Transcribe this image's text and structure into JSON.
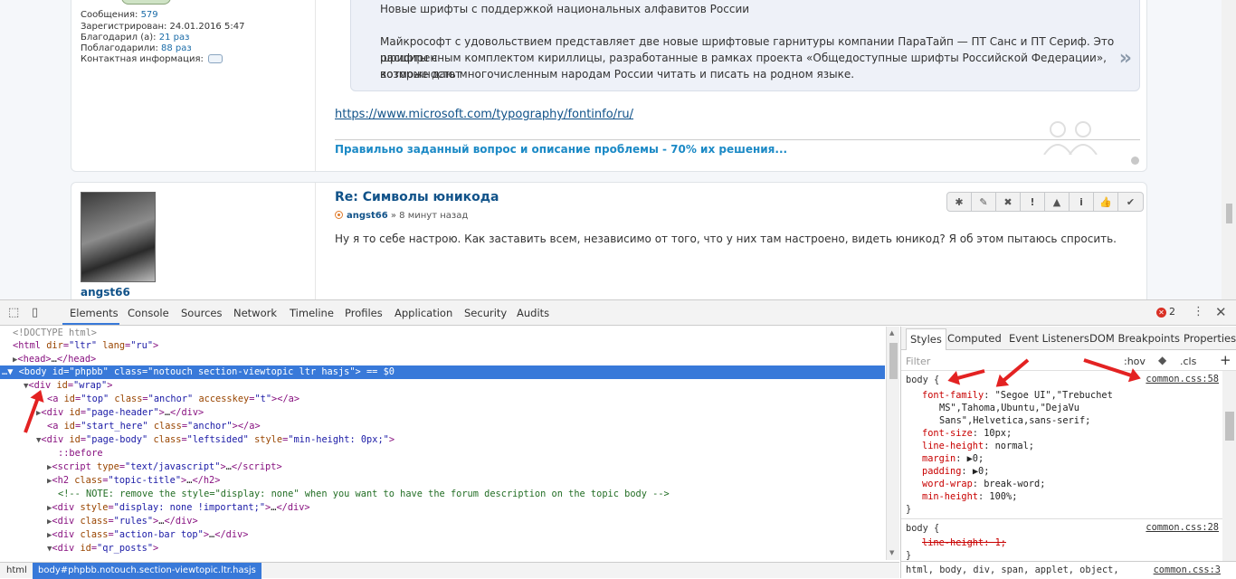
{
  "post1": {
    "profile": [
      {
        "label": "Сообщения: ",
        "value": "579"
      },
      {
        "label": "Зарегистрирован: 24.01.2016 5:47",
        "value": ""
      },
      {
        "label": "Благодарил (а): ",
        "value": "21 раз"
      },
      {
        "label": "Поблагодарили: ",
        "value": "88 раз"
      },
      {
        "label": "Контактная информация: ",
        "value": ""
      }
    ],
    "quote_title": "Новые шрифты с поддержкой национальных алфавитов России",
    "quote_body_1": "Майкрософт с удовольствием представляет две новые шрифтовые гарнитуры компании ПараТайп — ПТ Санс и ПТ Сериф. Это шрифты с",
    "quote_body_2": "расширенным комплектом кириллицы, разработанные в рамках проекта «Общедоступные шрифты Российской Федерации», которые дают",
    "quote_body_3": "возможность многочисленным народам России читать и писать на родном языке.",
    "quote_more": "»",
    "link": "https://www.microsoft.com/typography/fontinfo/ru/",
    "signature": "Правильно заданный вопрос и описание проблемы - 70% их решения..."
  },
  "post2": {
    "username": "angst66",
    "title": "Re: Символы юникода",
    "meta_user": "angst66",
    "meta_time": " » 8 минут назад",
    "text": "Ну я то себе настрою. Как заставить всем, независимо от того, что у них там настроено, видеть юникод? Я об этом пытаюсь спросить.",
    "tools": [
      "✱",
      "✎",
      "✖",
      "!",
      "▲",
      "i",
      "👍",
      "✔"
    ]
  },
  "devtools": {
    "tabs": [
      "Elements",
      "Console",
      "Sources",
      "Network",
      "Timeline",
      "Profiles",
      "Application",
      "Security",
      "Audits"
    ],
    "error_count": "2",
    "breadcrumb_html": "html",
    "breadcrumb_body": "body#phpbb.notouch.section-viewtopic.ltr.hasjs",
    "styles_tabs": [
      "Styles",
      "Computed",
      "Event Listeners",
      "DOM Breakpoints",
      "Properties"
    ],
    "filter_placeholder": "Filter",
    "hov": ":hov",
    "cls": ".cls",
    "plus": "+",
    "rule1_selector": "body {",
    "rule1_source": "common.css:58",
    "rule1_props": [
      {
        "p": "font-family",
        "v": "\"Segoe UI\",\"Trebuchet"
      },
      {
        "p": "",
        "v": "MS\",Tahoma,Ubuntu,\"DejaVu"
      },
      {
        "p": "",
        "v": "Sans\",Helvetica,sans-serif;"
      },
      {
        "p": "font-size",
        "v": "10px;"
      },
      {
        "p": "line-height",
        "v": "normal;"
      },
      {
        "p": "margin",
        "v": "▶0;"
      },
      {
        "p": "padding",
        "v": "▶0;"
      },
      {
        "p": "word-wrap",
        "v": "break-word;"
      },
      {
        "p": "min-height",
        "v": "100%;"
      }
    ],
    "rule_close": "}",
    "rule2_selector": "body {",
    "rule2_source": "common.css:28",
    "rule2_prop": "line-height: 1;",
    "bottom_selectors": "html, body, div, span, applet, object,",
    "bottom_source": "common.css:3"
  }
}
